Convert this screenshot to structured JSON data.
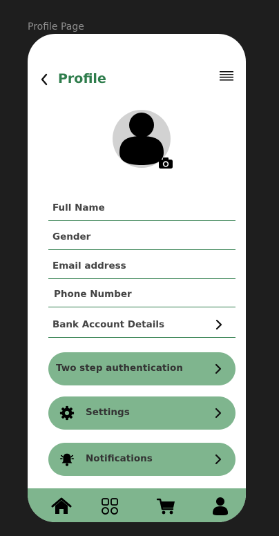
{
  "frame": {
    "label": "Profile Page"
  },
  "header": {
    "title": "Profile",
    "back_icon": "chevron-left-icon",
    "menu_icon": "menu-icon"
  },
  "avatar": {
    "icon": "user-icon",
    "camera_icon": "camera-icon"
  },
  "fields": [
    {
      "label": "Full Name"
    },
    {
      "label": "Gender"
    },
    {
      "label": "Email address"
    },
    {
      "label": "Phone Number"
    },
    {
      "label": "Bank Account Details",
      "chevron": true
    }
  ],
  "options": [
    {
      "label": "Two step authentication",
      "icon": null
    },
    {
      "label": "Settings",
      "icon": "gear-icon"
    },
    {
      "label": "Notifications",
      "icon": "bell-icon"
    }
  ],
  "bottom_nav": [
    {
      "name": "home",
      "icon": "home-icon"
    },
    {
      "name": "categories",
      "icon": "grid-icon"
    },
    {
      "name": "cart",
      "icon": "cart-icon"
    },
    {
      "name": "profile",
      "icon": "user-icon"
    }
  ],
  "colors": {
    "accent": "#2f7d4c",
    "pill": "#7fb58e",
    "background": "#1e1e1e"
  }
}
